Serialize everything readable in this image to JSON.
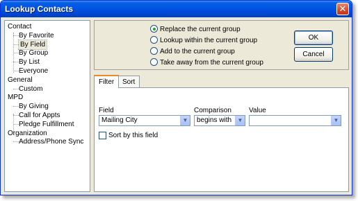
{
  "window": {
    "title": "Lookup Contacts",
    "close_glyph": "✕"
  },
  "tree": {
    "items": [
      {
        "label": "Contact",
        "level": 0
      },
      {
        "label": "By Favorite",
        "level": 1
      },
      {
        "label": "By Field",
        "level": 1,
        "selected": true
      },
      {
        "label": "By Group",
        "level": 1
      },
      {
        "label": "By List",
        "level": 1
      },
      {
        "label": "Everyone",
        "level": 1
      },
      {
        "label": "General",
        "level": 0
      },
      {
        "label": "Custom",
        "level": 1
      },
      {
        "label": "MPD",
        "level": 0
      },
      {
        "label": "By Giving",
        "level": 1
      },
      {
        "label": "Call for Appts",
        "level": 1
      },
      {
        "label": "Pledge Fulfillment",
        "level": 1
      },
      {
        "label": "Organization",
        "level": 0
      },
      {
        "label": "Address/Phone Sync",
        "level": 1
      }
    ]
  },
  "options": {
    "radios": [
      {
        "label": "Replace the current group",
        "checked": true
      },
      {
        "label": "Lookup within the current group",
        "checked": false
      },
      {
        "label": "Add to the current group",
        "checked": false
      },
      {
        "label": "Take away from the current group",
        "checked": false
      }
    ],
    "ok_label": "OK",
    "cancel_label": "Cancel"
  },
  "tabs": [
    {
      "label": "Filter",
      "active": true
    },
    {
      "label": "Sort",
      "active": false
    }
  ],
  "filter": {
    "field_label": "Field",
    "field_value": "Mailing City",
    "comparison_label": "Comparison",
    "comparison_value": "begins with",
    "value_label": "Value",
    "value_value": "",
    "sort_checkbox_label": "Sort by this field",
    "sort_checked": false
  },
  "icons": {
    "dropdown_arrow": "▼"
  },
  "colors": {
    "titlebar": "#0055e5",
    "radio_dot": "#21a121",
    "active_tab_accent": "#e68b2c"
  }
}
